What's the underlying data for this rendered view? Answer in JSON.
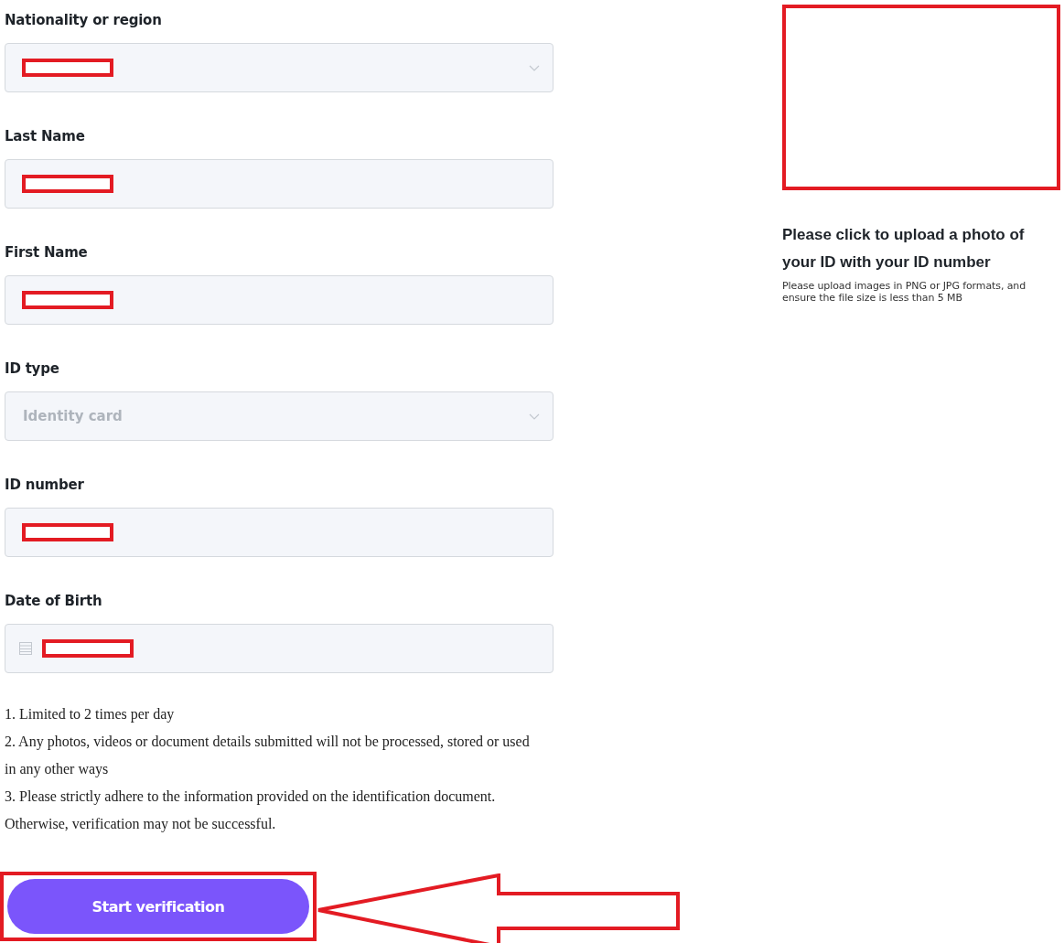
{
  "fields": [
    {
      "label": "Nationality or region",
      "kind": "select",
      "redacted": true
    },
    {
      "label": "Last Name",
      "kind": "text",
      "redacted": true
    },
    {
      "label": "First Name",
      "kind": "text",
      "redacted": true
    },
    {
      "label": "ID type",
      "kind": "select",
      "value": "Identity card",
      "disabled": true,
      "redacted": false
    },
    {
      "label": "ID number",
      "kind": "text",
      "redacted": true
    },
    {
      "label": "Date of Birth",
      "kind": "date",
      "redacted": true
    }
  ],
  "notes": [
    "1. Limited to 2 times per day",
    "2. Any photos, videos or document details submitted will not be processed, stored or used in any other ways",
    "3. Please strictly adhere to the information provided on the identification document. Otherwise, verification may not be successful."
  ],
  "submit_button": {
    "label": "Start verification",
    "highlighted": true
  },
  "annotation_arrow": true,
  "upload": {
    "highlighted": true,
    "title": "Please click to upload a photo of your ID with your ID number",
    "hint": "Please upload images in PNG or JPG formats, and ensure the file size is less than 5 MB"
  }
}
